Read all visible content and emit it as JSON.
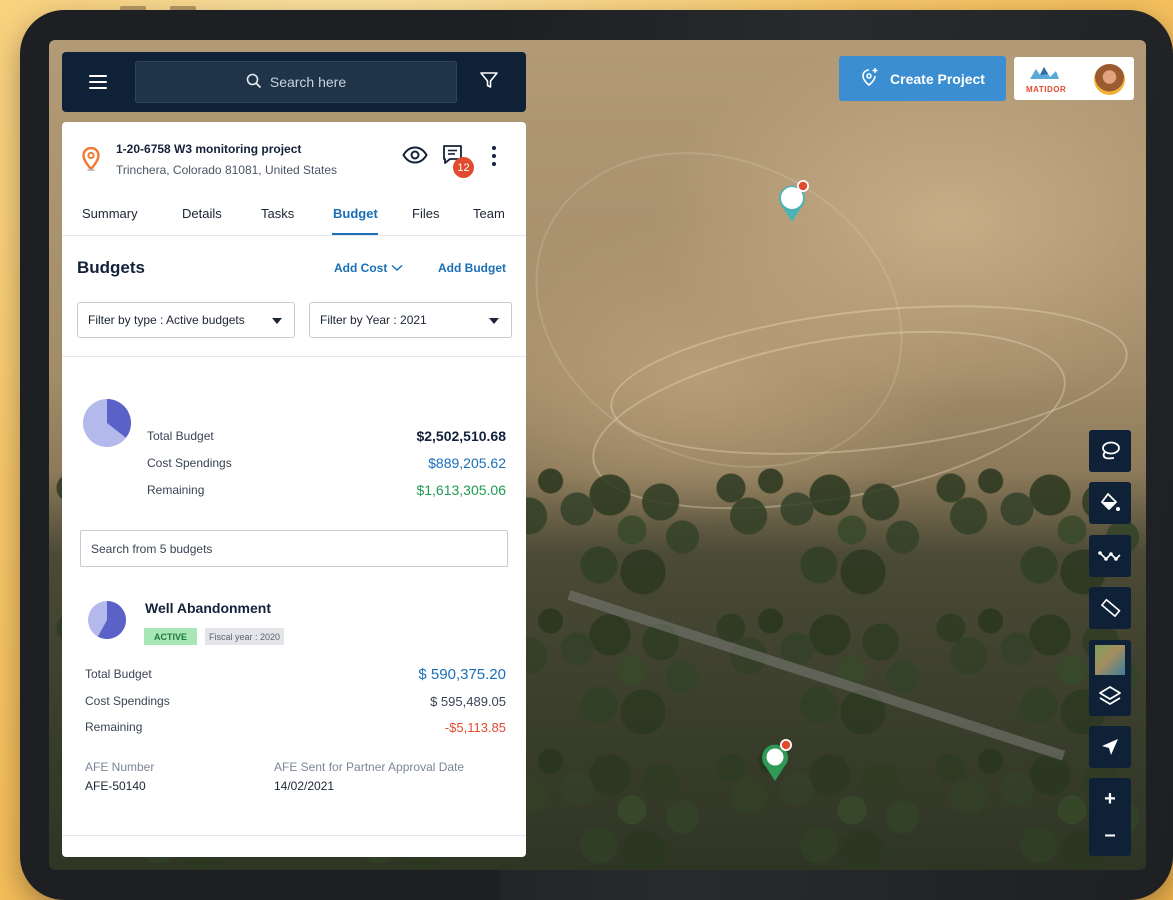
{
  "search": {
    "placeholder": "Search here"
  },
  "project": {
    "title": "1-20-6758 W3 monitoring project",
    "address": "Trinchera, Colorado 81081, United States",
    "comments_count": "12"
  },
  "tabs": [
    {
      "label": "Summary"
    },
    {
      "label": "Details"
    },
    {
      "label": "Tasks"
    },
    {
      "label": "Budget",
      "active": true
    },
    {
      "label": "Files"
    },
    {
      "label": "Team"
    }
  ],
  "budgets": {
    "title": "Budgets",
    "add_cost_label": "Add Cost",
    "add_budget_label": "Add Budget",
    "filter_type": "Filter by type : Active budgets",
    "filter_year": "Filter by Year : 2021",
    "summary": {
      "total_label": "Total Budget",
      "total_value": "$2,502,510.68",
      "spent_label": "Cost Spendings",
      "spent_value": "$889,205.62",
      "remaining_label": "Remaining",
      "remaining_value": "$1,613,305.06",
      "spent_fraction": 0.355
    },
    "search_placeholder": "Search from 5 budgets",
    "items": [
      {
        "name": "Well Abandonment",
        "status": "ACTIVE",
        "fiscal": "Fiscal year : 2020",
        "total_label": "Total Budget",
        "total_value": "$ 590,375.20",
        "spent_label": "Cost Spendings",
        "spent_value": "$ 595,489.05",
        "remaining_label": "Remaining",
        "remaining_value": "-$5,113.85",
        "afe_number_label": "AFE Number",
        "afe_number": "AFE-50140",
        "afe_date_label": "AFE Sent for Partner Approval Date",
        "afe_date": "14/02/2021",
        "spent_fraction": 0.58
      }
    ]
  },
  "header": {
    "create_project_label": "Create Project",
    "brand_name": "MATIDOR"
  },
  "colors": {
    "navy": "#0e2136",
    "accent_blue": "#1a6fb7",
    "button_blue": "#3b8ed2",
    "positive_green": "#1f9b4f",
    "negative_red": "#e24b2f",
    "pie_light": "#b4b9ec",
    "pie_dark": "#5a62c8"
  },
  "icons": {
    "menu": "hamburger-icon",
    "search": "search-icon",
    "filter": "filter-icon",
    "location": "location-pin-icon",
    "view": "eye-icon",
    "comments": "chat-icon",
    "more": "more-vertical-icon",
    "chevron": "chevron-down-icon",
    "create": "add-location-icon",
    "tools": [
      "lasso-icon",
      "paint-bucket-icon",
      "polyline-icon",
      "ruler-icon",
      "layers-icon",
      "navigate-icon"
    ]
  }
}
